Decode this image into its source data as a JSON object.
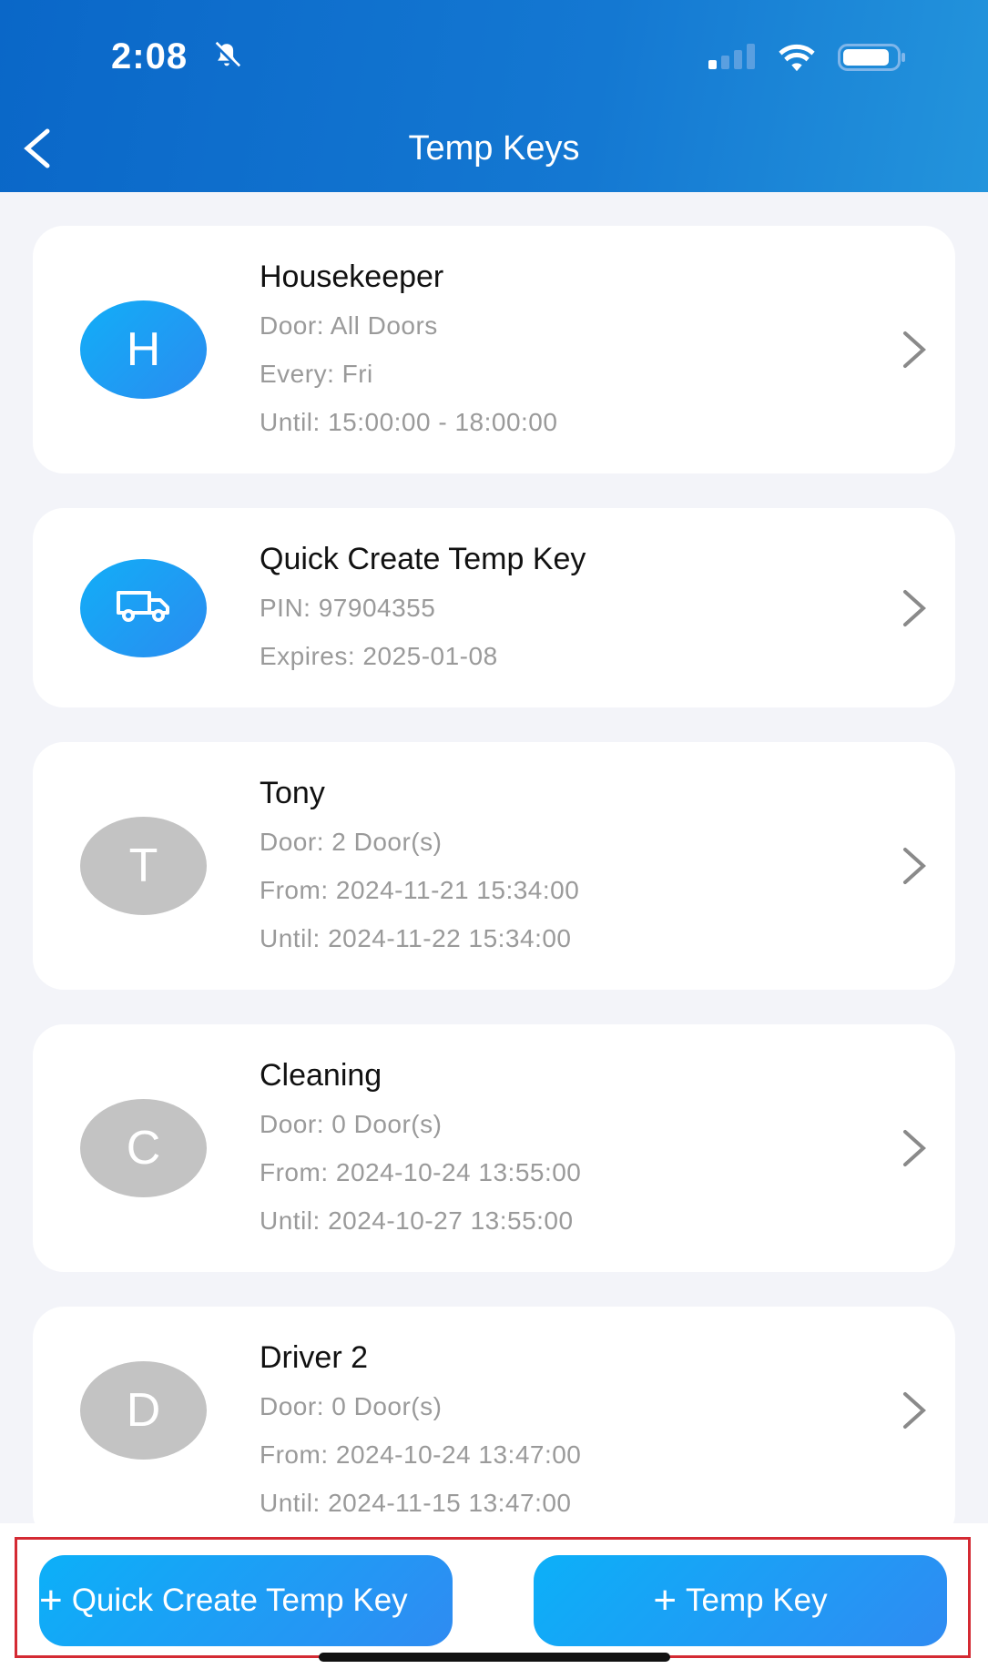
{
  "status_bar": {
    "time": "2:08",
    "icons": [
      "bell-slash-icon",
      "signal-icon",
      "wifi-icon",
      "battery-icon"
    ]
  },
  "header": {
    "title": "Temp Keys",
    "back_icon": "chevron-left-icon"
  },
  "keys": [
    {
      "avatar": "H",
      "avatar_style": "blue",
      "name": "Housekeeper",
      "lines": [
        "Door: All Doors",
        "Every: Fri",
        "Until: 15:00:00 - 18:00:00"
      ]
    },
    {
      "avatar_icon": "truck-icon",
      "avatar_style": "blue",
      "name": "Quick Create Temp Key",
      "lines": [
        "PIN: 97904355",
        "Expires: 2025-01-08"
      ]
    },
    {
      "avatar": "T",
      "avatar_style": "gray",
      "name": "Tony",
      "lines": [
        "Door: 2 Door(s)",
        "From: 2024-11-21 15:34:00",
        "Until: 2024-11-22 15:34:00"
      ]
    },
    {
      "avatar": "C",
      "avatar_style": "gray",
      "name": "Cleaning",
      "lines": [
        "Door: 0 Door(s)",
        "From: 2024-10-24 13:55:00",
        "Until: 2024-10-27 13:55:00"
      ]
    },
    {
      "avatar": "D",
      "avatar_style": "gray",
      "name": "Driver 2",
      "lines": [
        "Door: 0 Door(s)",
        "From: 2024-10-24 13:47:00",
        "Until: 2024-11-15 13:47:00"
      ]
    }
  ],
  "footer": {
    "quick_create_label": "Quick Create Temp Key",
    "temp_key_label": "Temp Key",
    "plus": "+"
  },
  "colors": {
    "header": "#0a67c8",
    "accent": "#12aef7",
    "gray_avatar": "#c3c3c3",
    "highlight_box": "#d42a33"
  }
}
